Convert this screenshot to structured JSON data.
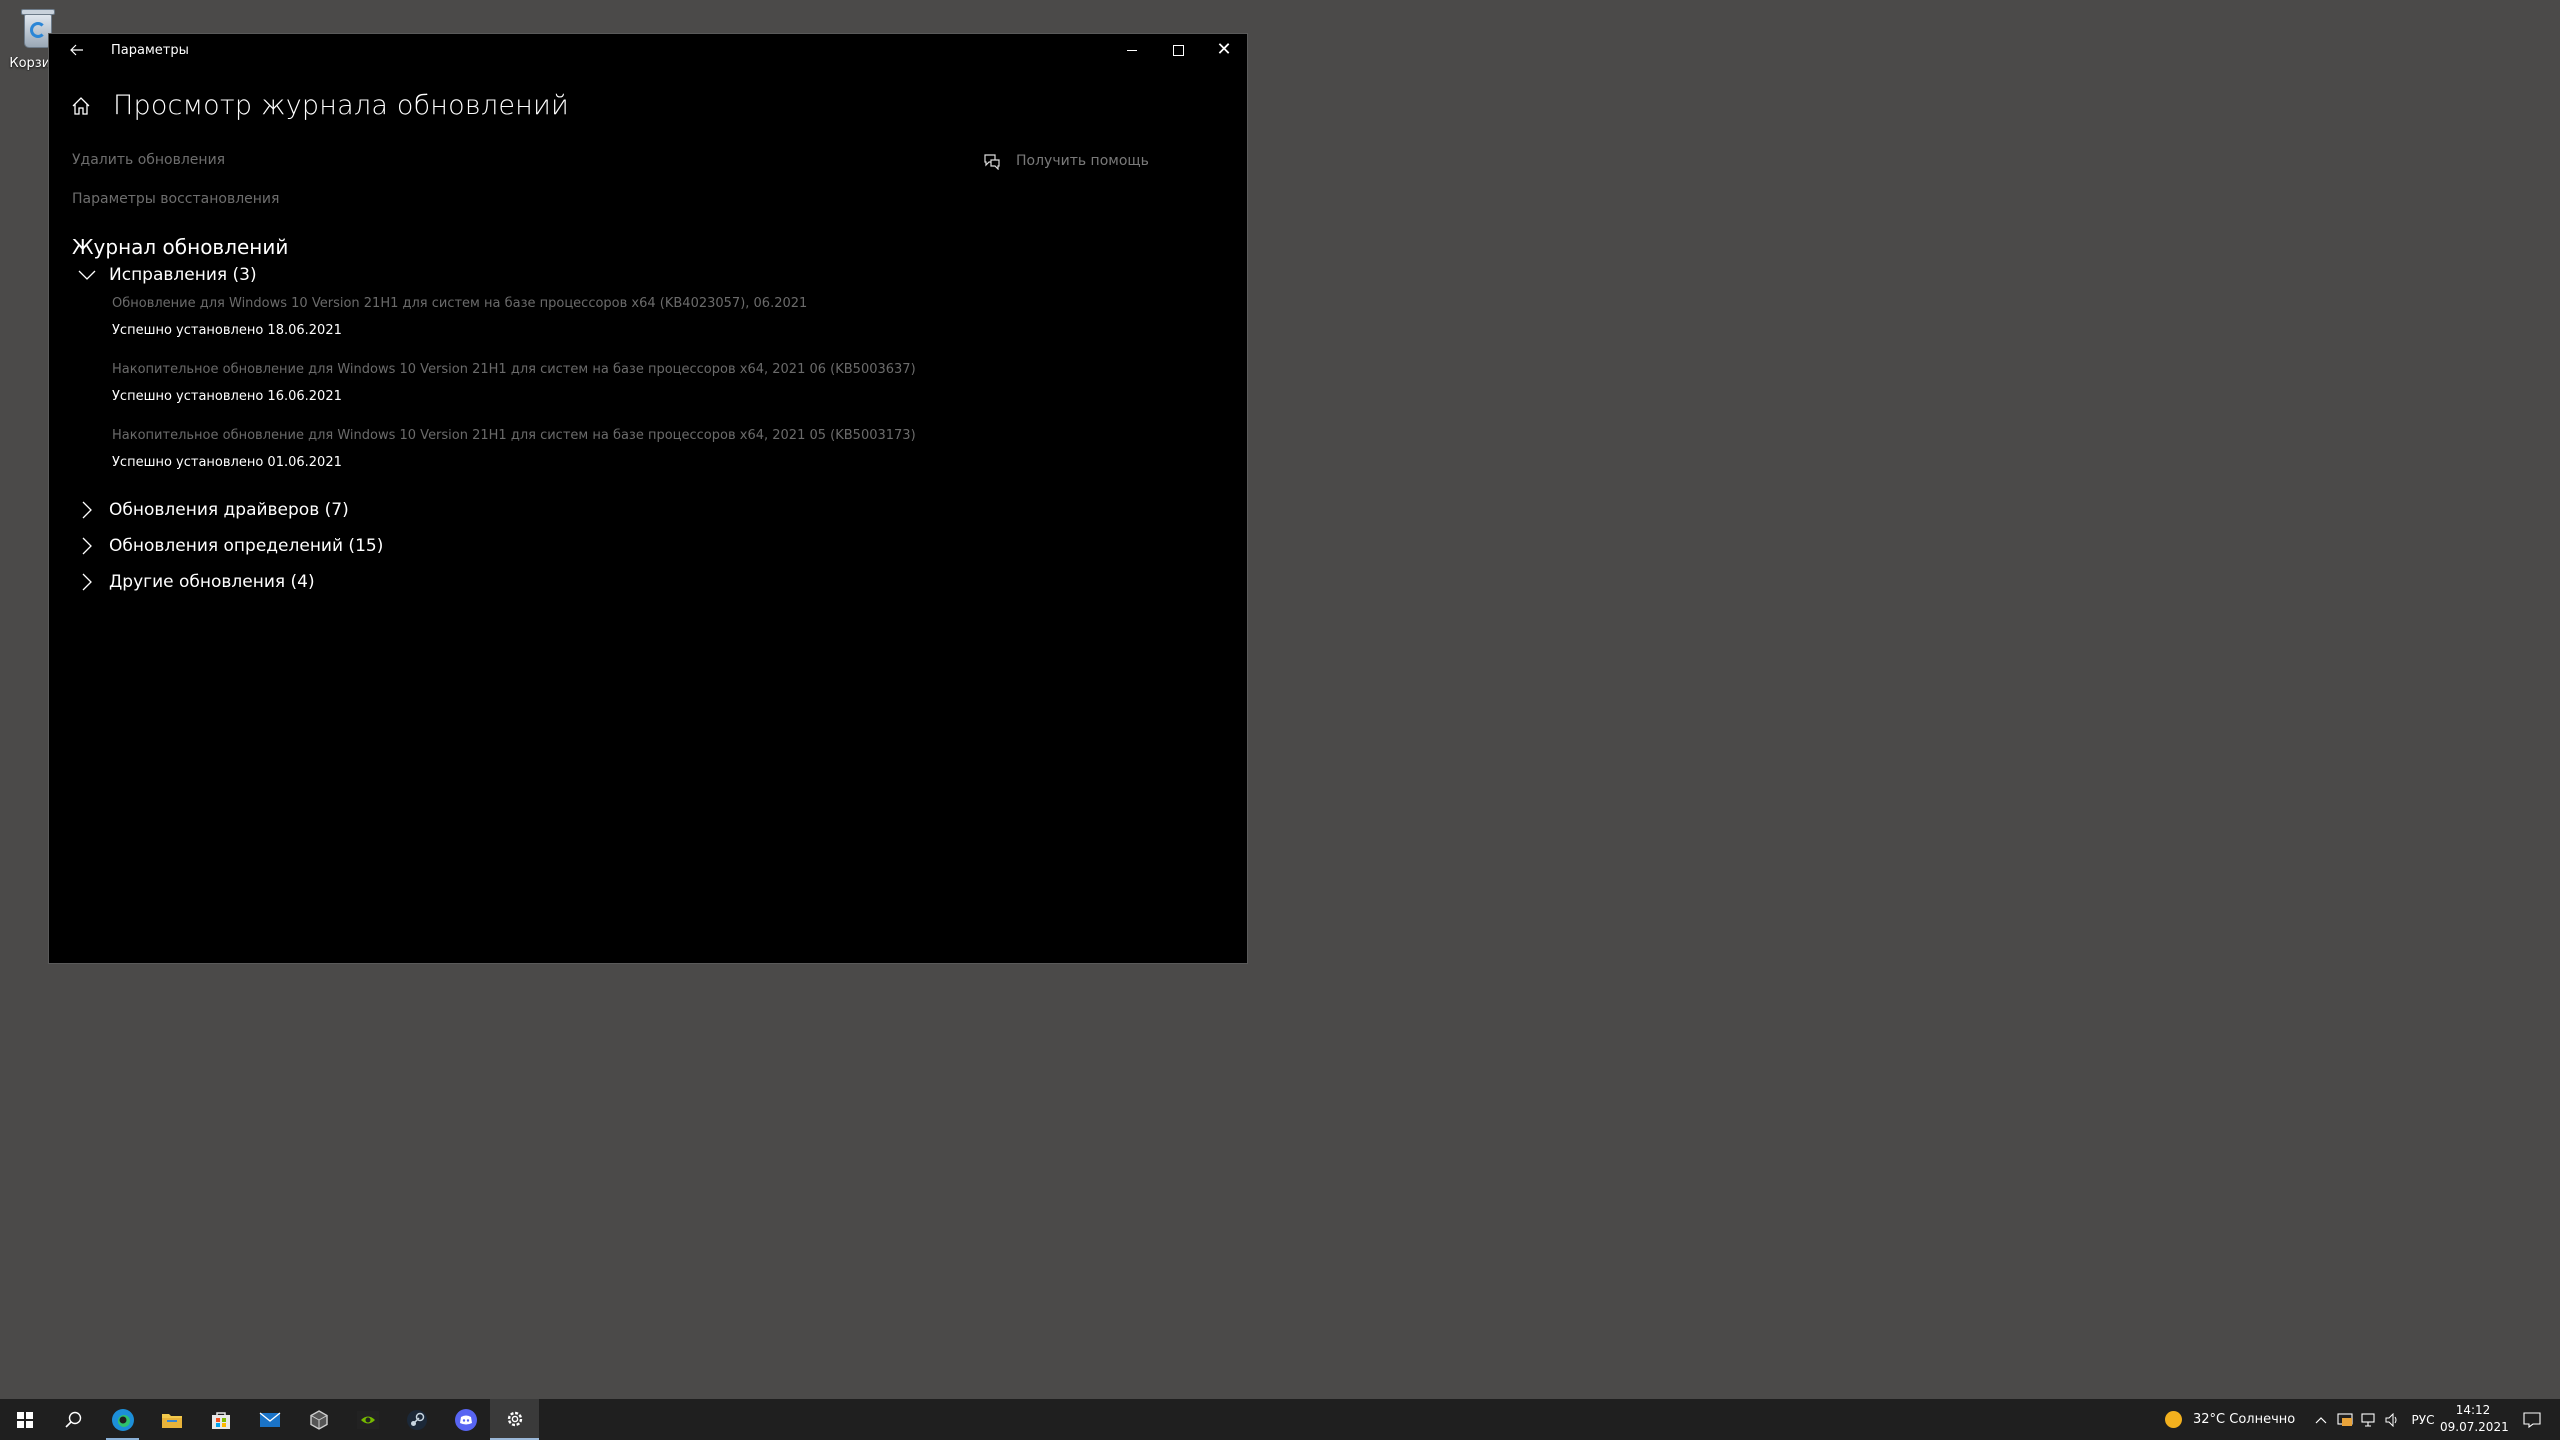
{
  "desktop": {
    "recycle_bin_label": "Корзина"
  },
  "window": {
    "title": "Параметры",
    "page_title": "Просмотр журнала обновлений",
    "links": {
      "uninstall": "Удалить обновления",
      "recovery": "Параметры восстановления"
    },
    "help_label": "Получить помощь",
    "section_title": "Журнал обновлений",
    "groups": [
      {
        "label": "Исправления (3)",
        "expanded": true
      },
      {
        "label": "Обновления драйверов (7)",
        "expanded": false
      },
      {
        "label": "Обновления определений (15)",
        "expanded": false
      },
      {
        "label": "Другие обновления (4)",
        "expanded": false
      }
    ],
    "updates": [
      {
        "name": "Обновление для Windows 10 Version 21H1 для систем на базе процессоров x64 (KB4023057), 06.2021",
        "status": "Успешно установлено 18.06.2021"
      },
      {
        "name": "Накопительное обновление для Windows 10 Version 21H1 для систем на базе процессоров x64, 2021 06 (KB5003637)",
        "status": "Успешно установлено 16.06.2021"
      },
      {
        "name": "Накопительное обновление для Windows 10 Version 21H1 для систем на базе процессоров x64, 2021 05 (KB5003173)",
        "status": "Успешно установлено 01.06.2021"
      }
    ]
  },
  "taskbar": {
    "apps": [
      "start-icon",
      "search-icon",
      "edge-icon",
      "file-explorer-icon",
      "store-icon",
      "mail-icon",
      "app-cube-icon",
      "nvidia-icon",
      "steam-icon",
      "discord-icon",
      "settings-icon"
    ],
    "active_app": "settings-icon",
    "weather": "32°C  Солнечно",
    "language": "РУС",
    "time": "14:12",
    "date": "09.07.2021"
  },
  "colors": {
    "window_bg": "#000000",
    "desktop_bg": "#4b4a49",
    "taskbar_bg": "#1f1f1f",
    "muted_text": "#6e6e6e",
    "weather_sun": "#f2b01e"
  }
}
